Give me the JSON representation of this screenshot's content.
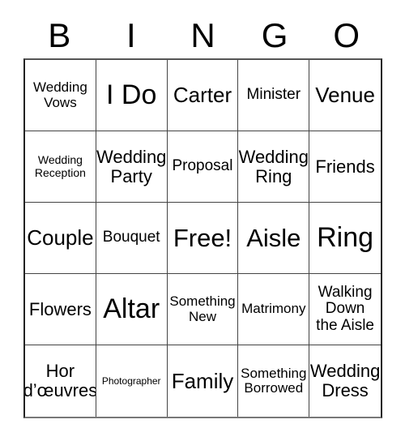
{
  "card": {
    "title": "BINGO",
    "header_letters": [
      "B",
      "I",
      "N",
      "G",
      "O"
    ],
    "columns": 5,
    "rows": 5,
    "free_space_label": "Free!",
    "free_space_position": "center",
    "theme_colors": {
      "background": "#ffffff",
      "text": "#000000",
      "grid_line": "#444444",
      "outer_border": "#222222"
    },
    "cells": [
      {
        "text": "Wedding\nVows",
        "size": "fs-md",
        "name": "cell-b1"
      },
      {
        "text": "I Do",
        "size": "fs-4xl",
        "name": "cell-i1"
      },
      {
        "text": "Carter",
        "size": "fs-2xl",
        "name": "cell-n1"
      },
      {
        "text": "Minister",
        "size": "fs-lg",
        "name": "cell-g1"
      },
      {
        "text": "Venue",
        "size": "fs-2xl",
        "name": "cell-o1"
      },
      {
        "text": "Wedding\nReception",
        "size": "fs-sm",
        "name": "cell-b2"
      },
      {
        "text": "Wedding\nParty",
        "size": "fs-xl",
        "name": "cell-i2"
      },
      {
        "text": "Proposal",
        "size": "fs-lg",
        "name": "cell-n2"
      },
      {
        "text": "Wedding\nRing",
        "size": "fs-xl",
        "name": "cell-g2"
      },
      {
        "text": "Friends",
        "size": "fs-xl",
        "name": "cell-o2"
      },
      {
        "text": "Couple",
        "size": "fs-2xl",
        "name": "cell-b3"
      },
      {
        "text": "Bouquet",
        "size": "fs-lg",
        "name": "cell-i3"
      },
      {
        "text": "Free!",
        "size": "fs-3xl",
        "name": "cell-n3-free"
      },
      {
        "text": "Aisle",
        "size": "fs-3xl",
        "name": "cell-g3"
      },
      {
        "text": "Ring",
        "size": "fs-4xl",
        "name": "cell-o3"
      },
      {
        "text": "Flowers",
        "size": "fs-xl",
        "name": "cell-b4"
      },
      {
        "text": "Altar",
        "size": "fs-4xl",
        "name": "cell-i4"
      },
      {
        "text": "Something\nNew",
        "size": "fs-md",
        "name": "cell-n4"
      },
      {
        "text": "Matrimony",
        "size": "fs-md",
        "name": "cell-g4"
      },
      {
        "text": "Walking\nDown\nthe Aisle",
        "size": "fs-lg",
        "name": "cell-o4"
      },
      {
        "text": "Hor\nd’œuvres",
        "size": "fs-xl",
        "name": "cell-b5"
      },
      {
        "text": "Photographer",
        "size": "fs-xs",
        "name": "cell-i5"
      },
      {
        "text": "Family",
        "size": "fs-2xl",
        "name": "cell-n5"
      },
      {
        "text": "Something\nBorrowed",
        "size": "fs-md",
        "name": "cell-g5"
      },
      {
        "text": "Wedding\nDress",
        "size": "fs-xl",
        "name": "cell-o5"
      }
    ]
  }
}
